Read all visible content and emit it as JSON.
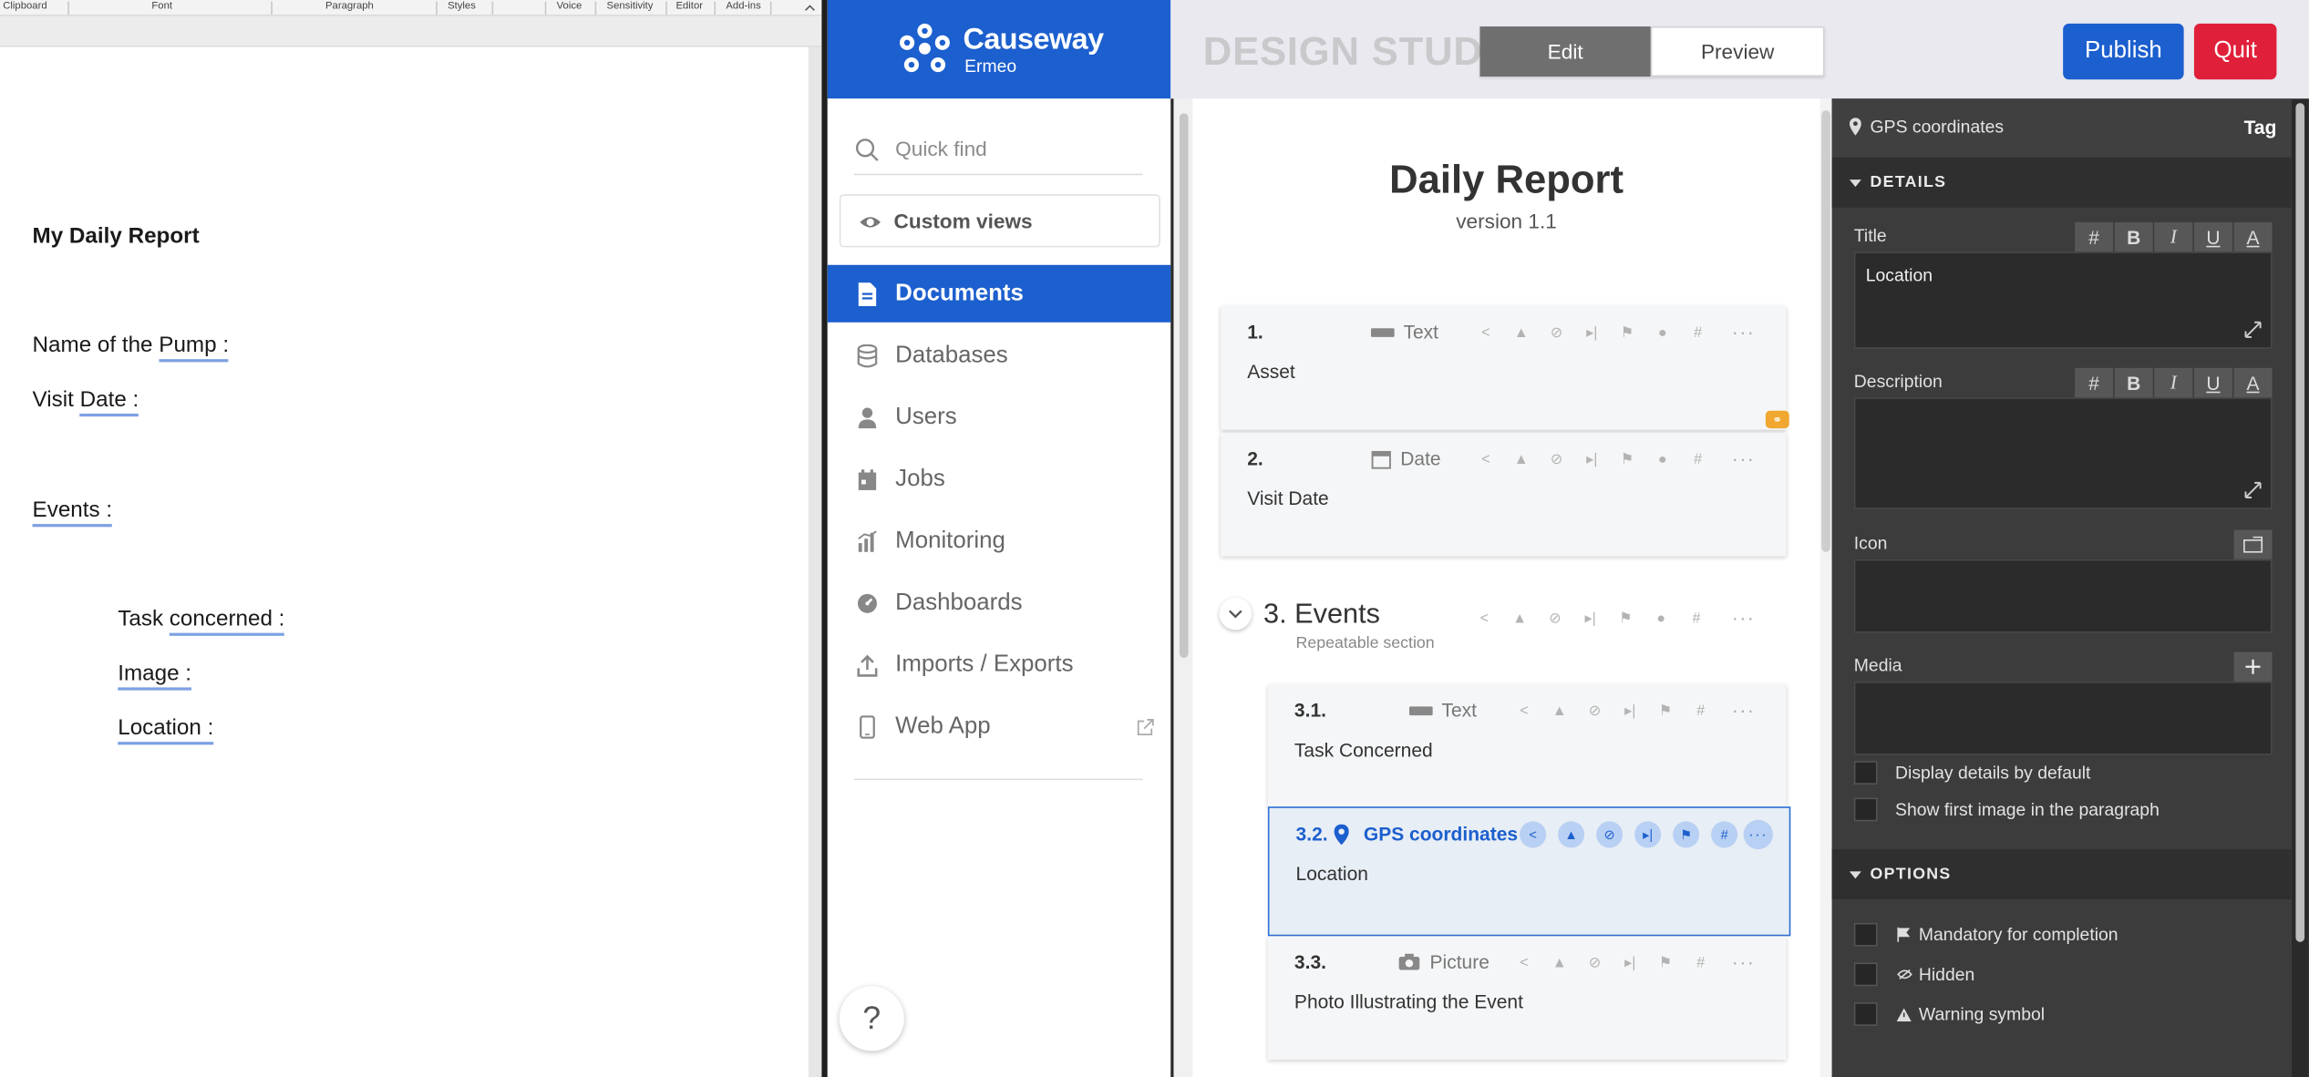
{
  "word": {
    "ribbon_groups": [
      "Clipboard",
      "Font",
      "Paragraph",
      "Styles",
      "Voice",
      "Sensitivity",
      "Editor",
      "Add-ins"
    ],
    "doc_title": "My Daily Report",
    "lines": {
      "pump_prefix": "Name of the ",
      "pump_word": "Pump :",
      "date_prefix": "Visit ",
      "date_word": "Date :",
      "events": "Events  :",
      "task_prefix": "Task ",
      "task_word": "concerned :",
      "image": "Image :",
      "location": "Location :"
    }
  },
  "app": {
    "logo": {
      "name": "Causeway",
      "sub": "Ermeo"
    },
    "studio_title": "DESIGN STUDIO",
    "mode_tabs": [
      "Edit",
      "Preview"
    ],
    "active_mode": "Edit",
    "publish_label": "Publish",
    "quit_label": "Quit",
    "colors": {
      "brand": "#1c5fce",
      "quit": "#e0203a",
      "panel": "#3c3c3c"
    }
  },
  "sidebar": {
    "quick_find_placeholder": "Quick find",
    "custom_views": "Custom views",
    "items": [
      {
        "label": "Documents",
        "icon": "document-icon",
        "active": true
      },
      {
        "label": "Databases",
        "icon": "database-icon"
      },
      {
        "label": "Users",
        "icon": "user-icon"
      },
      {
        "label": "Jobs",
        "icon": "calendar-icon"
      },
      {
        "label": "Monitoring",
        "icon": "bar-chart-icon"
      },
      {
        "label": "Dashboards",
        "icon": "gauge-icon"
      },
      {
        "label": "Imports / Exports",
        "icon": "upload-icon"
      },
      {
        "label": "Web App",
        "icon": "mobile-icon"
      }
    ],
    "help": "?"
  },
  "form": {
    "title": "Daily Report",
    "version": "version 1.1",
    "fields": [
      {
        "num": "1.",
        "type": "Text",
        "label": "Asset"
      },
      {
        "num": "2.",
        "type": "Date",
        "label": "Visit Date"
      }
    ],
    "section": {
      "title": "3. Events",
      "subtitle": "Repeatable section"
    },
    "section_fields": [
      {
        "num": "3.1.",
        "type": "Text",
        "label": "Task Concerned"
      },
      {
        "num": "3.2.",
        "type": "GPS coordinates",
        "label": "Location",
        "selected": true
      },
      {
        "num": "3.3.",
        "type": "Picture",
        "label": "Photo Illustrating the Event"
      }
    ],
    "more": "···"
  },
  "props": {
    "header": "GPS coordinates",
    "tag": "Tag",
    "details_label": "DETAILS",
    "title_label": "Title",
    "title_value": "Location",
    "description_label": "Description",
    "icon_label": "Icon",
    "media_label": "Media",
    "format_buttons": [
      "#",
      "B",
      "I",
      "U",
      "A"
    ],
    "checkboxes": [
      "Display details by default",
      "Show first image in the paragraph"
    ],
    "options_label": "OPTIONS",
    "options": [
      "Mandatory for completion",
      "Hidden",
      "Warning symbol"
    ]
  }
}
